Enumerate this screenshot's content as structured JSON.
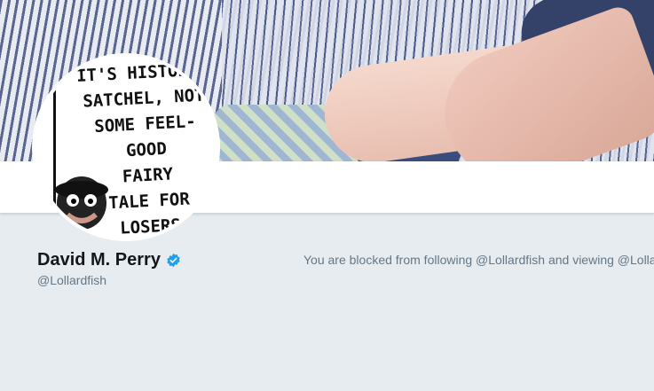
{
  "profile": {
    "display_name": "David M. Perry",
    "handle": "@Lollardfish",
    "verified_icon": "verified-badge-icon",
    "avatar_text": "IT'S HISTORY,\nSATCHEL, NOT\nSOME FEEL-\nGOOD\nFAIRY\nTALE FOR\nLOSERS"
  },
  "notice": {
    "blocked_text": "You are blocked from following @Lollardfish and viewing @Lolla"
  },
  "colors": {
    "page_bg": "#e6ecf0",
    "verified_blue": "#1da1f2",
    "muted_text": "#657786",
    "name_text": "#14171a"
  }
}
